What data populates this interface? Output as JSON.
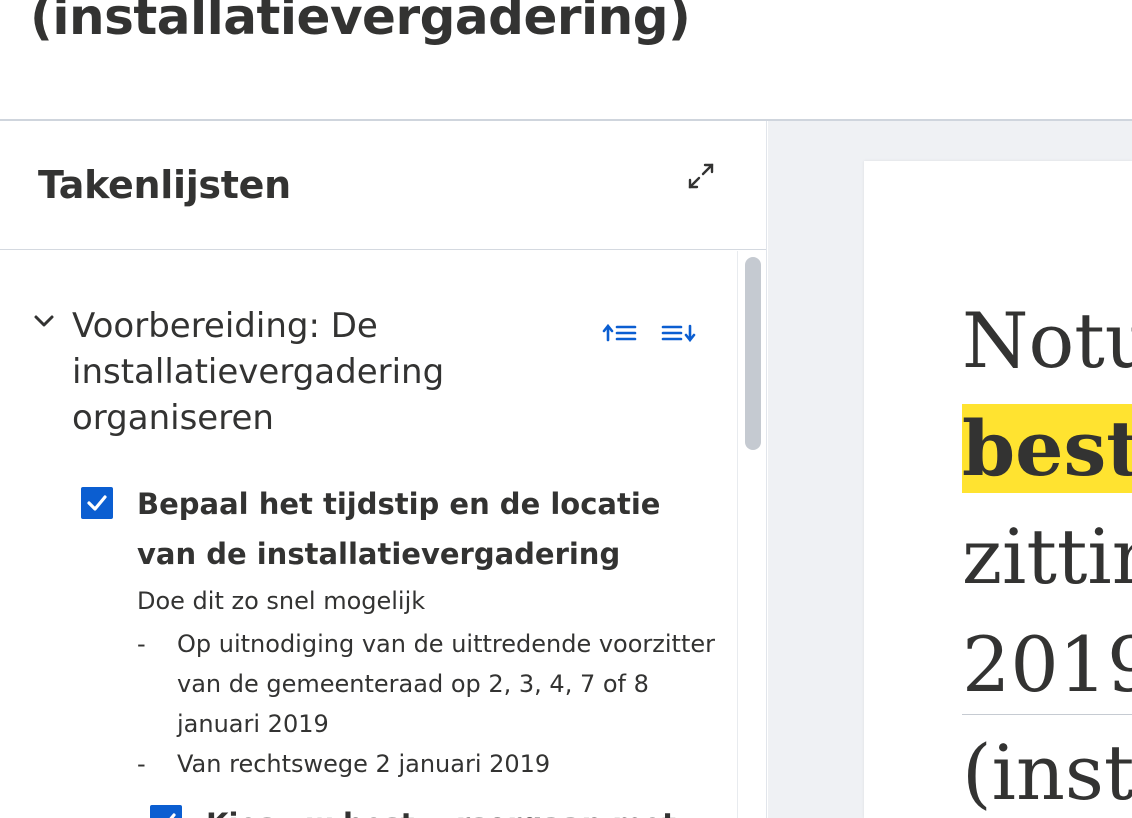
{
  "page": {
    "title": "(installatievergadering)"
  },
  "panel": {
    "title": "Takenlijsten",
    "expand_icon": "expand-arrows-icon"
  },
  "section": {
    "title": "Voorbereiding: De installatievergadering organiseren",
    "chevron_icon": "chevron-down-icon",
    "sort_up_icon": "sort-ascending-icon",
    "sort_down_icon": "sort-descending-icon"
  },
  "tasks": [
    {
      "checked": true,
      "title": "Bepaal het tijdstip en de locatie van de installatievergadering",
      "description": "Doe dit zo snel mogelijk",
      "bullets": [
        "Op uitnodiging van de uittredende voorzitter van de gemeenteraad op 2, 3, 4, 7 of 8 januari 2019",
        "Van rechtswege 2 januari 2019"
      ]
    },
    {
      "checked": true,
      "title": "Kies uw bestuursorgaan met"
    }
  ],
  "document": {
    "lines": [
      "Notu",
      "best",
      "zittin",
      "2019",
      "(inst"
    ],
    "highlight_color": "#ffe330"
  },
  "colors": {
    "accent": "#0b5ed1",
    "text": "#333332",
    "highlight": "#ffe330"
  }
}
